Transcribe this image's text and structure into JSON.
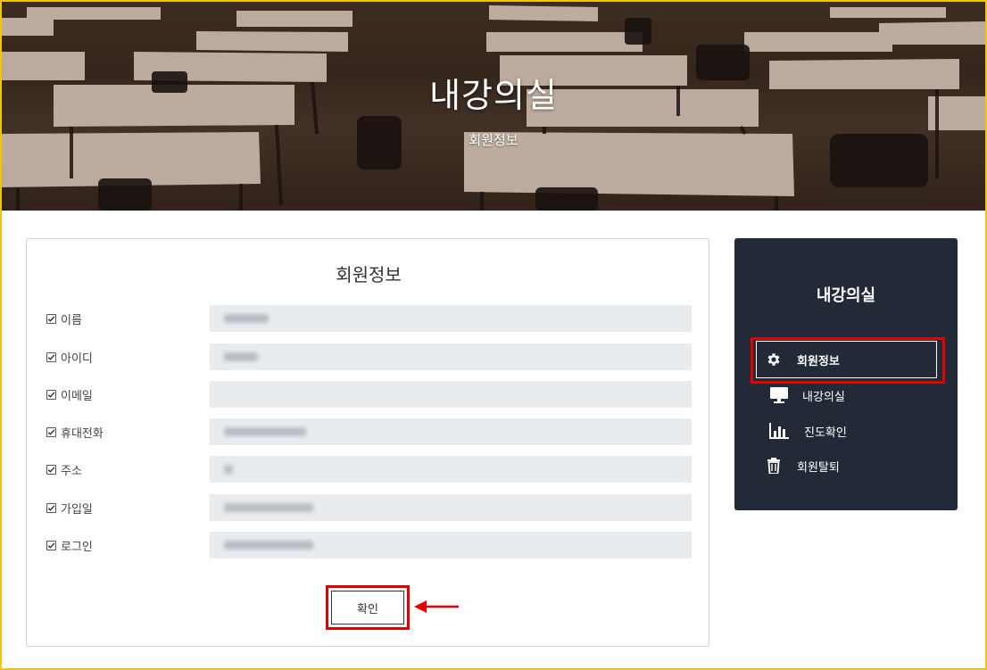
{
  "hero": {
    "title": "내강의실",
    "subtitle": "회원정보"
  },
  "card": {
    "title": "회원정보",
    "fields": [
      {
        "label": "이름",
        "blur_width": 50
      },
      {
        "label": "아이디",
        "blur_width": 38
      },
      {
        "label": "이메일",
        "blur_width": 0
      },
      {
        "label": "휴대전화",
        "blur_width": 92
      },
      {
        "label": "주소",
        "blur_width": 10
      },
      {
        "label": "가입일",
        "blur_width": 100
      },
      {
        "label": "로그인",
        "blur_width": 100
      }
    ],
    "confirm_label": "확인"
  },
  "sidebar": {
    "title": "내강의실",
    "items": [
      {
        "label": "회원정보",
        "icon": "gear-icon",
        "active": true
      },
      {
        "label": "내강의실",
        "icon": "monitor-icon",
        "active": false
      },
      {
        "label": "진도확인",
        "icon": "bar-chart-icon",
        "active": false
      },
      {
        "label": "회원탈퇴",
        "icon": "trash-icon",
        "active": false
      }
    ]
  },
  "colors": {
    "highlight": "#e00000",
    "frame": "#f1c40f",
    "sidebar_bg": "#232a37",
    "input_bg": "#e9ecef"
  }
}
